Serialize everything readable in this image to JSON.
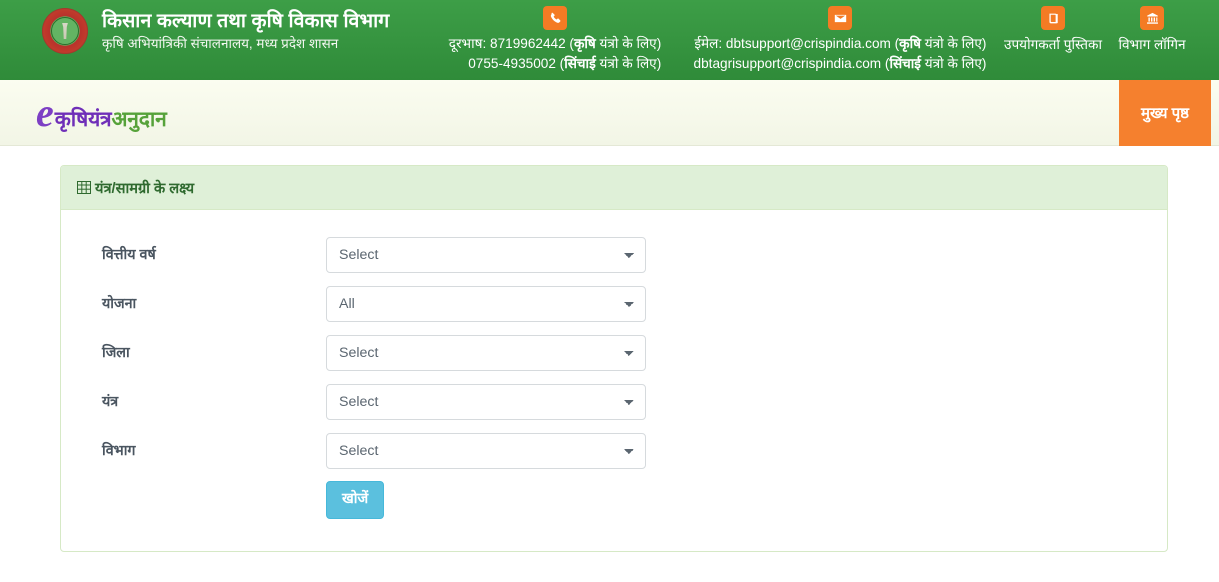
{
  "header": {
    "emblem_alt": "madhya-pradesh-government-emblem",
    "dept_title": "किसान कल्याण तथा कृषि विकास विभाग",
    "dept_subtitle": "कृषि अभियांत्रिकी संचालनालय, मध्य प्रदेश शासन",
    "phone": {
      "icon": "phone-icon",
      "line1_prefix": "दूरभाष: 8719962442 (",
      "line1_bold": "कृषि",
      "line1_suffix": " यंत्रो के लिए)",
      "line2_prefix": "0755-4935002 (",
      "line2_bold": "सिंचाई",
      "line2_suffix": " यंत्रो के लिए)"
    },
    "email": {
      "icon": "envelope-icon",
      "line1_prefix": "ईमेल: dbtsupport@crispindia.com (",
      "line1_bold": "कृषि",
      "line1_suffix": " यंत्रो के लिए)",
      "line2_prefix": "dbtagrisupport@crispindia.com (",
      "line2_bold": "सिंचाई",
      "line2_suffix": " यंत्रो के लिए)"
    },
    "user_manual": {
      "icon": "book-icon",
      "label": "उपयोगकर्ता पुस्तिका"
    },
    "dept_login": {
      "icon": "bank-icon",
      "label": "विभाग लॉगिन"
    }
  },
  "navbar": {
    "logo_e": "e",
    "logo_part1": "कृषियंत्र",
    "logo_part2": "अनुदान",
    "home_button": "मुख्य पृष्ठ"
  },
  "panel": {
    "icon": "grid-table-icon",
    "title": "यंत्र/सामग्री के लक्ष्य",
    "fields": [
      {
        "label": "वित्तीय वर्ष",
        "value": "Select",
        "name": "financial-year"
      },
      {
        "label": "योजना",
        "value": "All",
        "name": "scheme"
      },
      {
        "label": "जिला",
        "value": "Select",
        "name": "district"
      },
      {
        "label": "यंत्र",
        "value": "Select",
        "name": "equipment"
      },
      {
        "label": "विभाग",
        "value": "Select",
        "name": "department"
      }
    ],
    "search_button": "खोजें"
  },
  "colors": {
    "header_green_top": "#3d9e47",
    "header_green_bottom": "#2f8b39",
    "icon_orange": "#f47b24",
    "nav_button_orange": "#f5802e",
    "logo_purple": "#6f2fb8",
    "logo_green": "#56a23a",
    "panel_head_green": "#dff0d8",
    "panel_border_green": "#d6e9c6",
    "search_button_blue": "#5bc0de"
  }
}
